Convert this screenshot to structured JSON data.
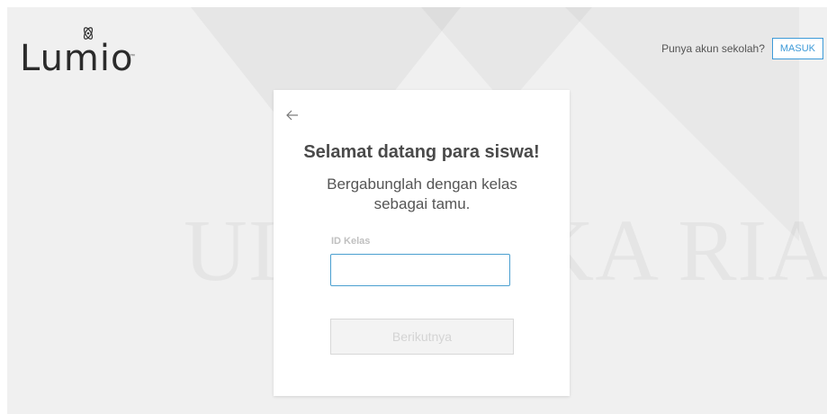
{
  "brand": {
    "name": "Lumio",
    "trademark": "™"
  },
  "header": {
    "account_prompt": "Punya akun sekolah?",
    "signin_label": "MASUK"
  },
  "card": {
    "title": "Selamat datang para siswa!",
    "subtitle": "Bergabunglah dengan kelas sebagai tamu.",
    "field_label": "ID Kelas",
    "field_value": "",
    "next_label": "Berikutnya"
  },
  "watermark": {
    "text": "UIN SUSKA RIAU"
  },
  "colors": {
    "accent": "#3d9ad8",
    "background": "#f0f0f0",
    "card": "#ffffff"
  },
  "icons": {
    "back": "arrow-left-icon",
    "logo": "atom-icon"
  }
}
